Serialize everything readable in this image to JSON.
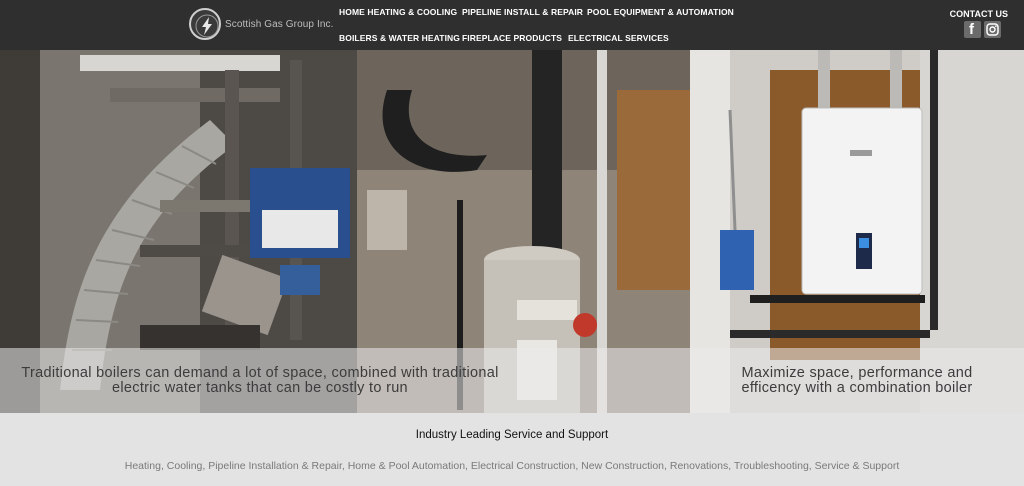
{
  "brand": {
    "name": "Scottish Gas Group Inc."
  },
  "nav": {
    "row1": [
      "HOME HEATING & COOLING",
      "PIPELINE INSTALL & REPAIR",
      "POOL EQUIPMENT & AUTOMATION"
    ],
    "row2": [
      "BOILERS & WATER HEATING",
      "FIREPLACE PRODUCTS",
      "ELECTRICAL SERVICES"
    ],
    "contact": "CONTACT US"
  },
  "social": {
    "facebook_icon": "facebook-icon",
    "instagram_icon": "instagram-icon"
  },
  "hero": {
    "caption_left": "Traditional boilers can demand a lot of space, combined with traditional electric water tanks that can be costly to run",
    "caption_right": "Maximize space, performance and efficency with a combination boiler"
  },
  "footer": {
    "title": "Industry Leading Service and Support",
    "services": "Heating, Cooling, Pipeline Installation & Repair, Home & Pool Automation, Electrical Construction, New Construction, Renovations, Troubleshooting, Service & Support"
  }
}
